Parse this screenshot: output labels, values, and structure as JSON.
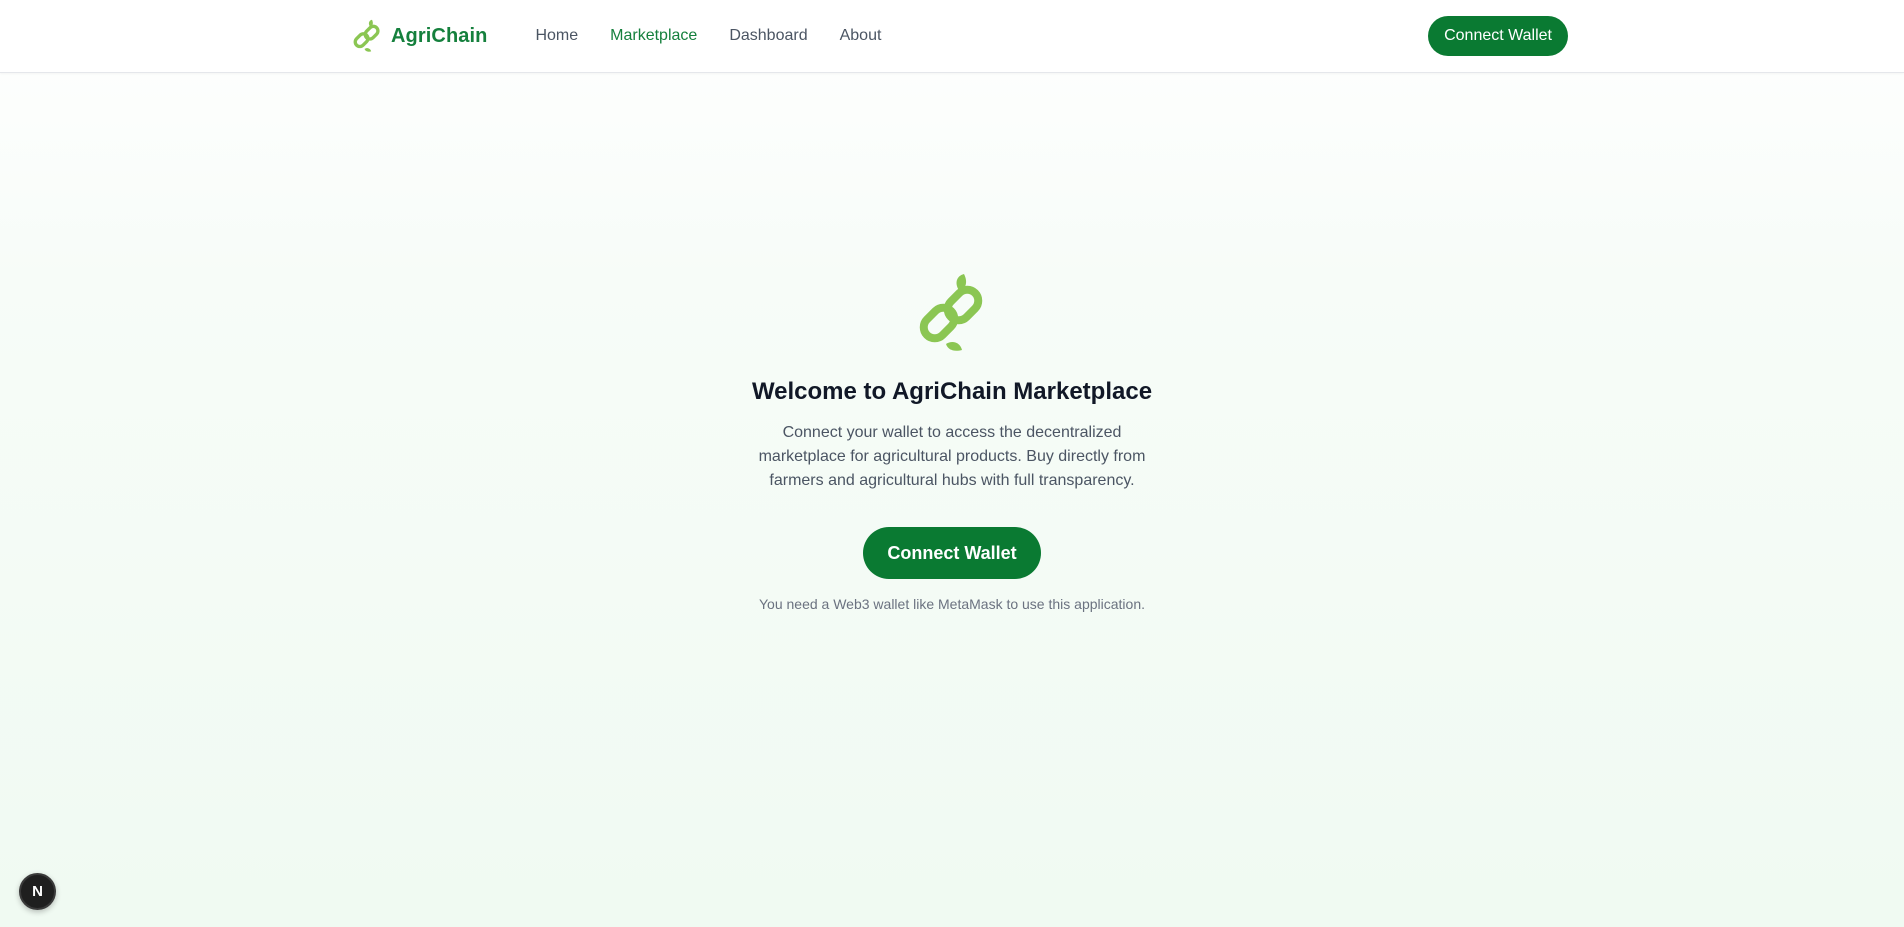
{
  "nav": {
    "brand": "AgriChain",
    "links": [
      {
        "label": "Home",
        "active": false
      },
      {
        "label": "Marketplace",
        "active": true
      },
      {
        "label": "Dashboard",
        "active": false
      },
      {
        "label": "About",
        "active": false
      }
    ],
    "connect_label": "Connect Wallet"
  },
  "hero": {
    "title": "Welcome to AgriChain Marketplace",
    "description": "Connect your wallet to access the decentralized marketplace for agricultural products. Buy directly from farmers and agricultural hubs with full transparency.",
    "connect_label": "Connect Wallet",
    "note": "You need a Web3 wallet like MetaMask to use this application."
  },
  "dev_badge": {
    "label": "N"
  },
  "colors": {
    "brand_green": "#15803d",
    "button_green": "#0a7a32",
    "logo_green": "#8bc653"
  },
  "icons": {
    "brand_logo": "chain-leaf-icon",
    "hero_logo": "chain-leaf-icon"
  }
}
